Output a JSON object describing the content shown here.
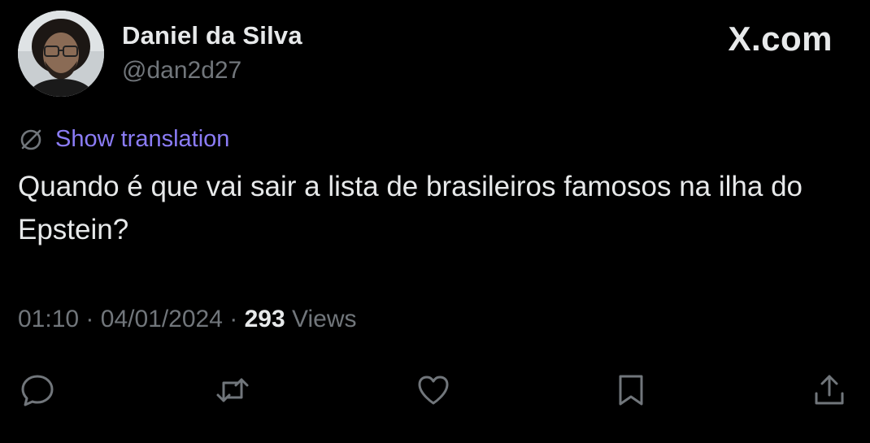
{
  "user": {
    "display_name": "Daniel da Silva",
    "handle": "@dan2d27",
    "avatar_icon": "person-photo-avatar"
  },
  "brand": "X.com",
  "translation": {
    "icon": "globe-slash-icon",
    "label": "Show translation"
  },
  "tweet": {
    "text": "Quando é que vai sair a lista de brasileiros famosos na ilha do Epstein?"
  },
  "meta": {
    "time": "01:10",
    "date": "04/01/2024",
    "views_count": "293",
    "views_label": "Views",
    "separator": "·"
  },
  "actions": [
    {
      "name": "reply",
      "icon": "reply-bubble-icon"
    },
    {
      "name": "repost",
      "icon": "repost-icon"
    },
    {
      "name": "like",
      "icon": "heart-icon"
    },
    {
      "name": "bookmark",
      "icon": "bookmark-icon"
    },
    {
      "name": "share",
      "icon": "share-upload-icon"
    }
  ],
  "colors": {
    "background": "#000000",
    "primary_text": "#e7e9ea",
    "secondary_text": "#71767b",
    "link": "#8b7cf6"
  }
}
